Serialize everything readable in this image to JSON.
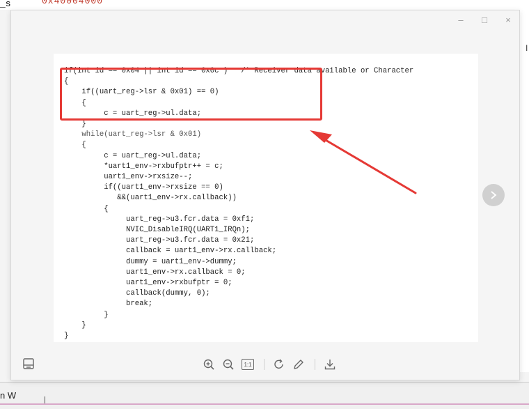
{
  "background": {
    "top_left_fragment": "_s",
    "top_red_fragment": "0x40004000",
    "right_fragment": "l",
    "bottom_left_fragment": "n W"
  },
  "window_controls": {
    "minimize": "–",
    "maximize": "□",
    "close": "×"
  },
  "code": {
    "lines": [
      "if(int id == 0x04 || int id == 0x0c )   /* Receiver data available or Character",
      "{",
      "    if((uart_reg->lsr & 0x01) == 0)",
      "    {",
      "         c = uart_reg->ul.data;",
      "    }",
      "    while(uart_reg->lsr & 0x01)",
      "    {",
      "         c = uart_reg->ul.data;",
      "         *uart1_env->rxbufptr++ = c;",
      "         uart1_env->rxsize--;",
      "         if((uart1_env->rxsize == 0)",
      "            &&(uart1_env->rx.callback))",
      "         {",
      "              uart_reg->u3.fcr.data = 0xf1;",
      "              NVIC_DisableIRQ(UART1_IRQn);",
      "              uart_reg->u3.fcr.data = 0x21;",
      "              callback = uart1_env->rx.callback;",
      "              dummy = uart1_env->dummy;",
      "              uart1_env->rx.callback = 0;",
      "              uart1_env->rxbufptr = 0;",
      "              callback(dummy, 0);",
      "              break;",
      "         }",
      "    }",
      "}"
    ]
  },
  "toolbar": {
    "ratio_label": "1:1"
  },
  "icons": {
    "nav_next": "chevron-right-icon",
    "panel": "panel-toggle-icon",
    "zoom_in": "zoom-in-icon",
    "zoom_out": "zoom-out-icon",
    "actual_size": "actual-size-icon",
    "rotate": "rotate-icon",
    "edit": "edit-icon",
    "download": "download-icon"
  },
  "colors": {
    "highlight": "#e53935",
    "comment": "#2e7d32"
  }
}
